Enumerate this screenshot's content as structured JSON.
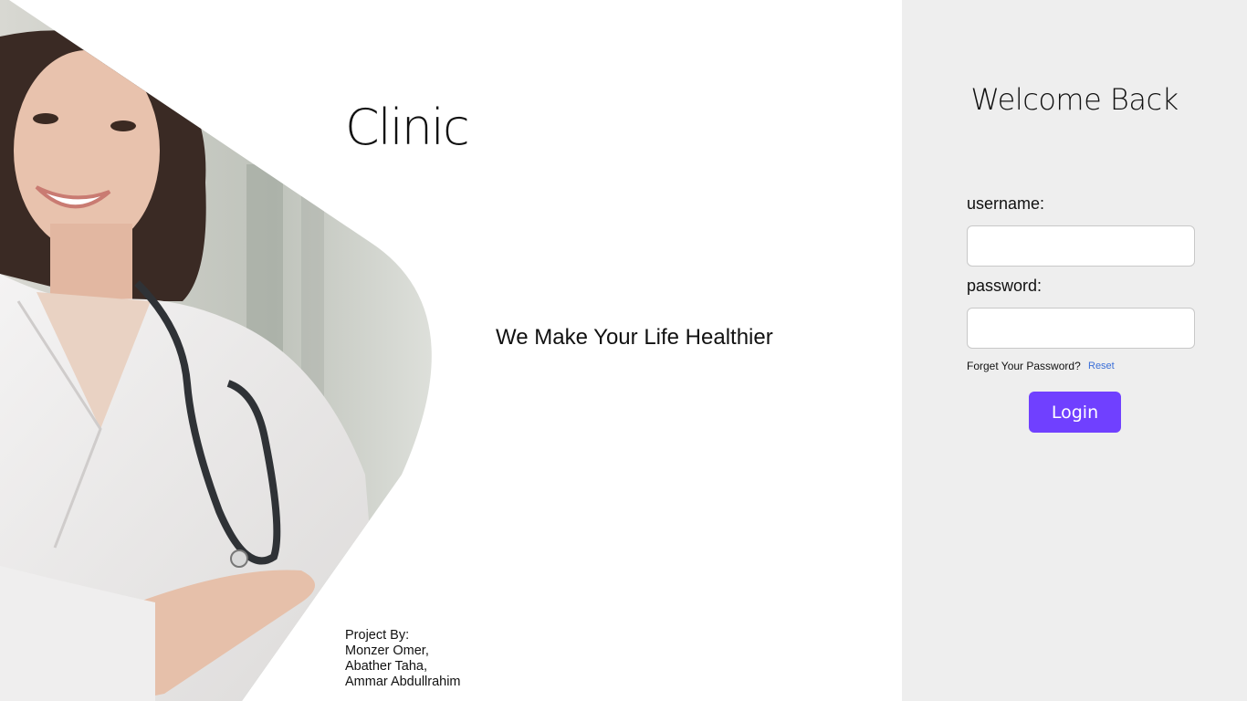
{
  "hero": {
    "title": "Clinic",
    "tagline": "We Make Your Life Healthier",
    "credits": {
      "heading": "Project By:",
      "authors": [
        "Monzer Omer,",
        "Abather Taha,",
        "Ammar Abdullrahim"
      ]
    }
  },
  "login": {
    "welcome": "Welcome Back",
    "username_label": "username:",
    "username_value": "",
    "password_label": "password:",
    "password_value": "",
    "forgot_text": "Forget Your Password?",
    "reset_label": "Reset",
    "login_label": "Login"
  },
  "colors": {
    "panel_bg": "#eeeeee",
    "accent": "#7040ff",
    "link": "#3b6fd8"
  }
}
